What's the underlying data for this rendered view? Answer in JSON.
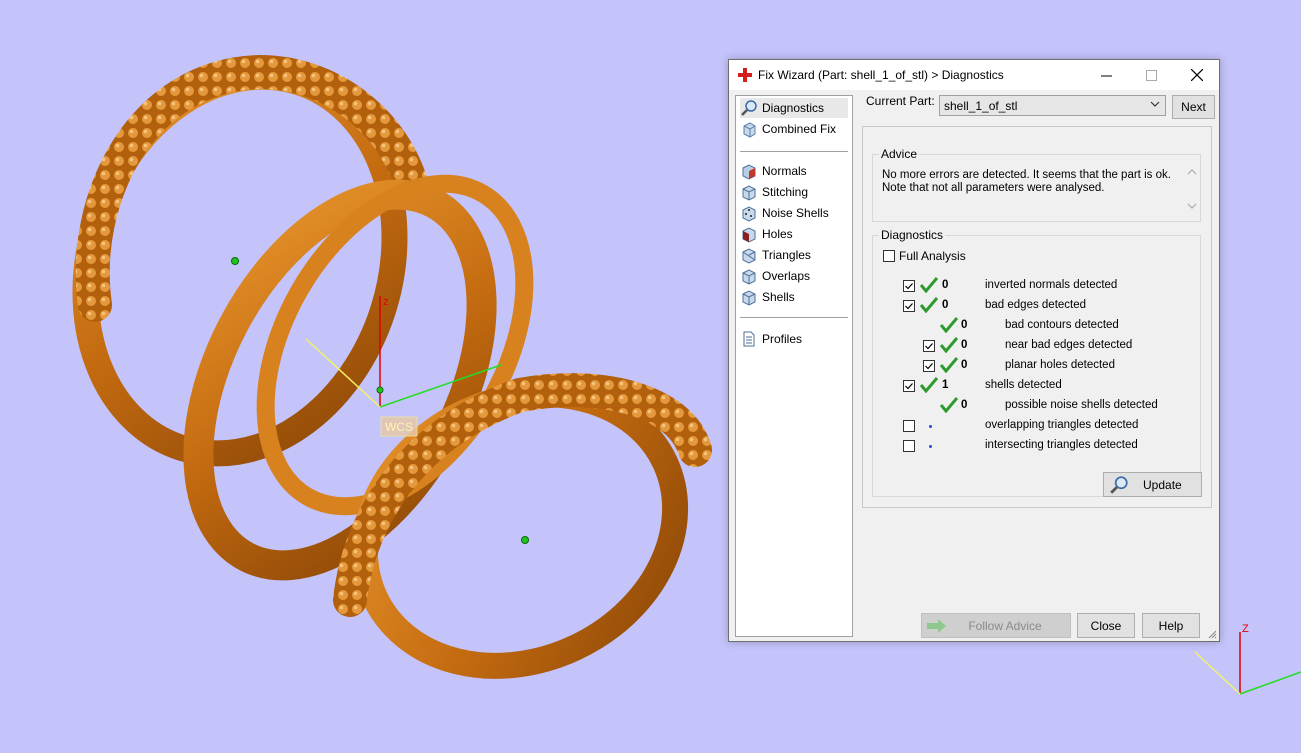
{
  "viewport": {
    "wcs_label": "WCS",
    "axis_z_label": "z",
    "corner_axis_z_label": "Z",
    "background": "#c4c4fb",
    "ring_color": "#c8700f"
  },
  "dialog": {
    "title": "Fix Wizard (Part: shell_1_of_stl) > Diagnostics",
    "nav": {
      "top_items": [
        {
          "label": "Diagnostics",
          "icon": "magnifier-icon"
        },
        {
          "label": "Combined Fix",
          "icon": "cube-icon"
        }
      ],
      "fix_items": [
        {
          "label": "Normals",
          "icon": "normals-cube-icon"
        },
        {
          "label": "Stitching",
          "icon": "stitching-cube-icon"
        },
        {
          "label": "Noise Shells",
          "icon": "noise-cube-icon"
        },
        {
          "label": "Holes",
          "icon": "holes-cube-icon"
        },
        {
          "label": "Triangles",
          "icon": "triangles-cube-icon"
        },
        {
          "label": "Overlaps",
          "icon": "overlaps-cube-icon"
        },
        {
          "label": "Shells",
          "icon": "shells-cube-icon"
        }
      ],
      "profiles": {
        "label": "Profiles",
        "icon": "document-icon"
      }
    },
    "current_part_label": "Current Part:",
    "current_part_value": "shell_1_of_stl",
    "next_label": "Next",
    "advice": {
      "title": "Advice",
      "line1": "No more errors are detected. It seems that the part is ok.",
      "line2": "Note that not all parameters were analysed."
    },
    "diagnostics": {
      "title": "Diagnostics",
      "full_analysis_label": "Full Analysis",
      "full_analysis_checked": false,
      "rows": [
        {
          "count": "0",
          "text": "inverted normals detected",
          "checked": true
        },
        {
          "count": "0",
          "text": "bad edges detected",
          "checked": true
        },
        {
          "count": "0",
          "text": "bad contours detected"
        },
        {
          "count": "0",
          "text": "near bad edges detected",
          "checked": true
        },
        {
          "count": "0",
          "text": "planar holes detected",
          "checked": true
        },
        {
          "count": "1",
          "text": "shells detected",
          "checked": true
        },
        {
          "count": "0",
          "text": "possible noise shells detected"
        },
        {
          "count": "",
          "text": "overlapping triangles detected",
          "checked": false
        },
        {
          "count": "",
          "text": "intersecting triangles detected",
          "checked": false
        }
      ],
      "update_label": "Update"
    },
    "follow_advice_label": "Follow Advice",
    "close_label": "Close",
    "help_label": "Help"
  }
}
